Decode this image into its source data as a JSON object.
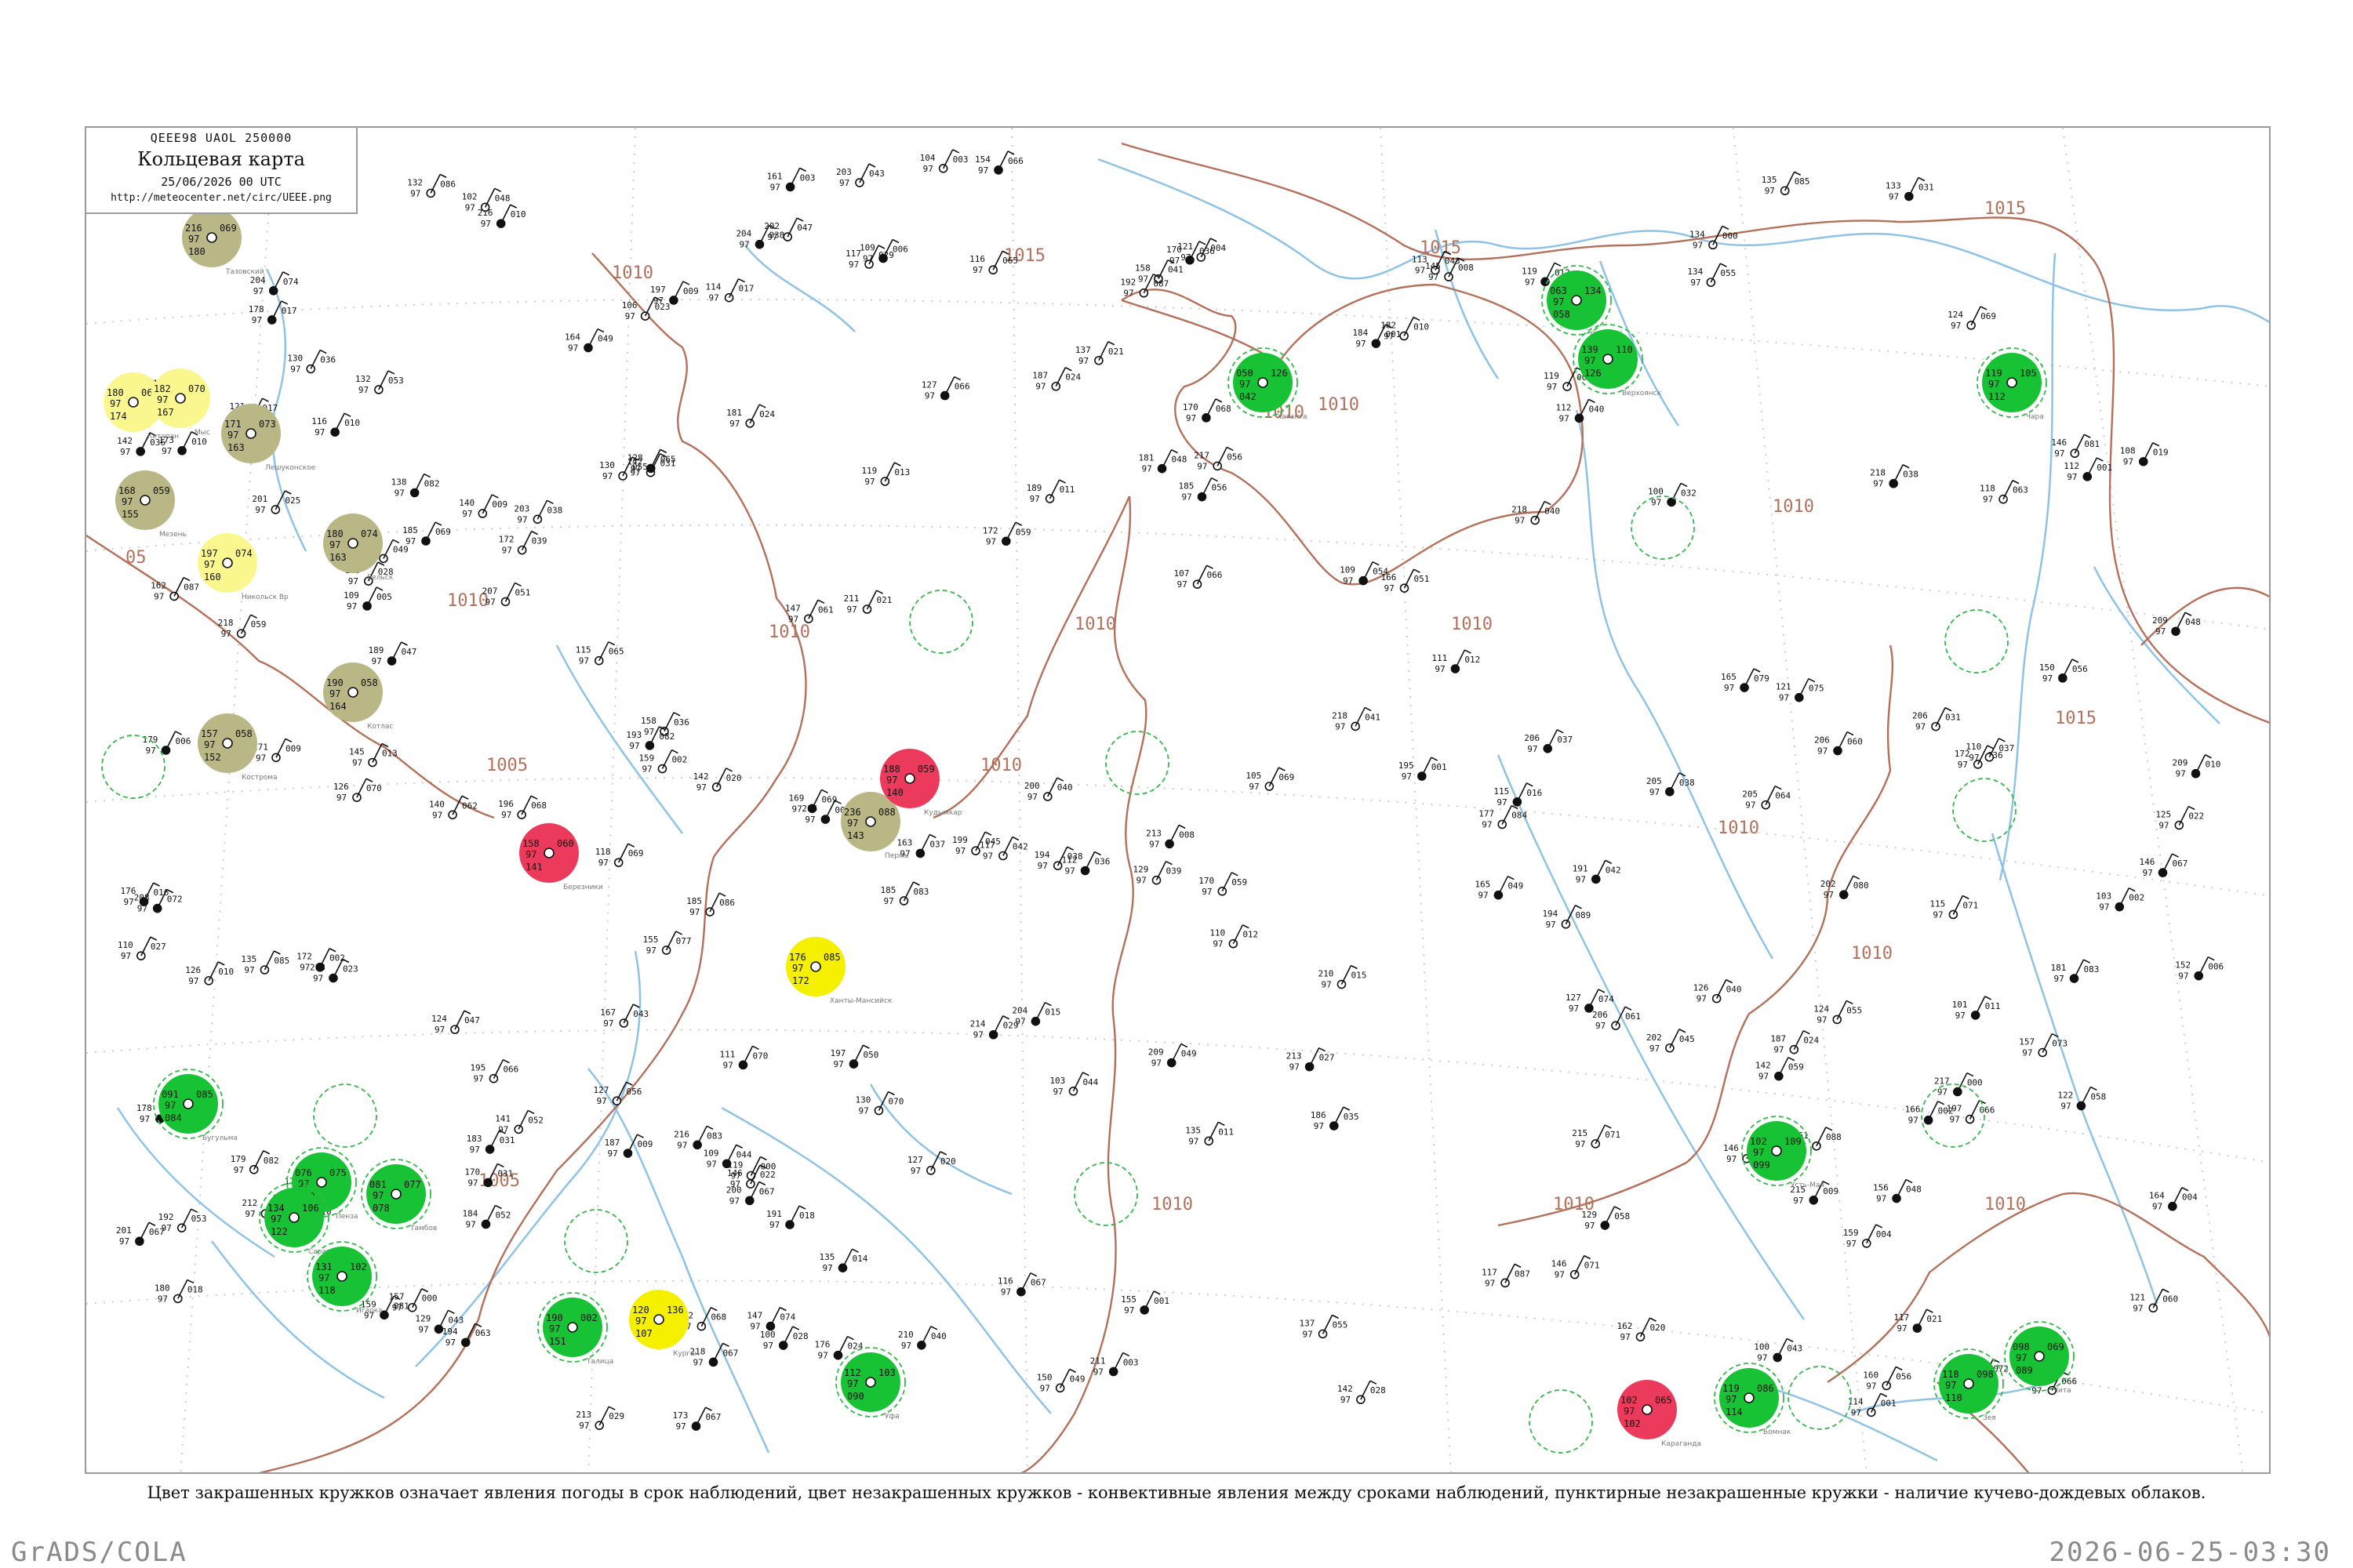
{
  "header": {
    "code_line": "QEEE98 UAOL 250000",
    "title": "Кольцевая карта",
    "date_line": "25/06/2026 00 UTC",
    "url": "http://meteocenter.net/circ/UEEE.png"
  },
  "caption": "Цвет закрашенных кружков означает явления погоды в срок наблюдений, цвет незакрашенных кружков - конвективные явления между сроками наблюдений, пунктирные незакрашенные кружки - наличие кучево-дождевых облаков.",
  "footer": {
    "left": "GrADS/COLA",
    "right": "2026-06-25-03:30"
  },
  "isobar_labels": [
    {
      "text": "1015"
    },
    {
      "text": "1015"
    },
    {
      "text": "1015"
    },
    {
      "text": "1015"
    },
    {
      "text": "1010"
    },
    {
      "text": "1010"
    },
    {
      "text": "1010"
    },
    {
      "text": "1010"
    },
    {
      "text": "1010"
    },
    {
      "text": "1010"
    },
    {
      "text": "1010"
    },
    {
      "text": "1010"
    },
    {
      "text": "1010"
    },
    {
      "text": "1010"
    },
    {
      "text": "1010"
    },
    {
      "text": "1010"
    },
    {
      "text": "1010"
    },
    {
      "text": "1010"
    },
    {
      "text": "1005"
    },
    {
      "text": "1005"
    },
    {
      "text": "05"
    }
  ],
  "colors": {
    "green": "#18c235",
    "olive": "#b9b785",
    "yellow_light": "#fbf78f",
    "yellow": "#f4f000",
    "red": "#ec3a5c",
    "isobar": "#b4705a",
    "water": "#8fc3e6",
    "ring": "#35b84a"
  },
  "stations": [
    {
      "name": "Тазовский",
      "temp": "216",
      "dew": "180",
      "p": "069",
      "fill": "olive"
    },
    {
      "name": "Кетапан",
      "temp": "180",
      "dew": "174",
      "p": "061",
      "fill": "yellow_light"
    },
    {
      "name": "Мыс",
      "temp": "182",
      "dew": "167",
      "p": "070",
      "fill": "yellow_light"
    },
    {
      "name": "Лешуконское",
      "temp": "171",
      "dew": "163",
      "p": "073",
      "fill": "olive"
    },
    {
      "name": "Мезень",
      "temp": "168",
      "dew": "155",
      "p": "059",
      "fill": "olive"
    },
    {
      "name": "Вельск",
      "temp": "180",
      "dew": "163",
      "p": "074",
      "fill": "olive"
    },
    {
      "name": "Никольск Вр",
      "temp": "197",
      "dew": "160",
      "p": "074",
      "fill": "yellow_light"
    },
    {
      "name": "Котлас",
      "temp": "190",
      "dew": "164",
      "p": "058",
      "fill": "olive"
    },
    {
      "name": "Кострома",
      "temp": "157",
      "dew": "152",
      "p": "058",
      "fill": "olive"
    },
    {
      "name": "Пермь",
      "temp": "236",
      "dew": "143",
      "p": "088",
      "fill": "olive"
    },
    {
      "name": "Кудымкар",
      "temp": "188",
      "dew": "140",
      "p": "059",
      "fill": "red"
    },
    {
      "name": "Березники",
      "temp": "158",
      "dew": "141",
      "p": "060",
      "fill": "red"
    },
    {
      "name": "Ханты-Мансийск",
      "temp": "176",
      "dew": "172",
      "p": "085",
      "fill": "yellow"
    },
    {
      "name": "Курган",
      "temp": "120",
      "dew": "107",
      "p": "136",
      "fill": "yellow"
    },
    {
      "name": "Караганда",
      "temp": "102",
      "dew": "102",
      "p": "065",
      "fill": "red"
    },
    {
      "name": "Талица",
      "temp": "190",
      "dew": "151",
      "p": "002",
      "fill": "green"
    },
    {
      "name": "Уфа",
      "temp": "112",
      "dew": "090",
      "p": "103",
      "fill": "green"
    },
    {
      "name": "Бугульма",
      "temp": "091",
      "dew": "084",
      "p": "085",
      "fill": "green"
    },
    {
      "name": "Пенза",
      "temp": "076",
      "dew": "070",
      "p": "075",
      "fill": "green"
    },
    {
      "name": "Тамбов",
      "temp": "081",
      "dew": "078",
      "p": "077",
      "fill": "green"
    },
    {
      "name": "Саратов",
      "temp": "134",
      "dew": "122",
      "p": "106",
      "fill": "green"
    },
    {
      "name": "Игарка",
      "temp": "131",
      "dew": "118",
      "p": "102",
      "fill": "green"
    },
    {
      "name": "Хатанга",
      "temp": "050",
      "dew": "042",
      "p": "126",
      "fill": "green"
    },
    {
      "name": "Оленек",
      "temp": "063",
      "dew": "058",
      "p": "134",
      "fill": "green"
    },
    {
      "name": "Верхоянск",
      "temp": "139",
      "dew": "126",
      "p": "110",
      "fill": "green"
    },
    {
      "name": "Чара",
      "temp": "119",
      "dew": "112",
      "p": "105",
      "fill": "green"
    },
    {
      "name": "Усть-Мая",
      "temp": "102",
      "dew": "099",
      "p": "109",
      "fill": "green"
    },
    {
      "name": "Бомнак",
      "temp": "119",
      "dew": "114",
      "p": "086",
      "fill": "green"
    },
    {
      "name": "Зея",
      "temp": "118",
      "dew": "110",
      "p": "098",
      "fill": "green"
    },
    {
      "name": "Чита",
      "temp": "098",
      "dew": "089",
      "p": "069",
      "fill": "green"
    }
  ]
}
